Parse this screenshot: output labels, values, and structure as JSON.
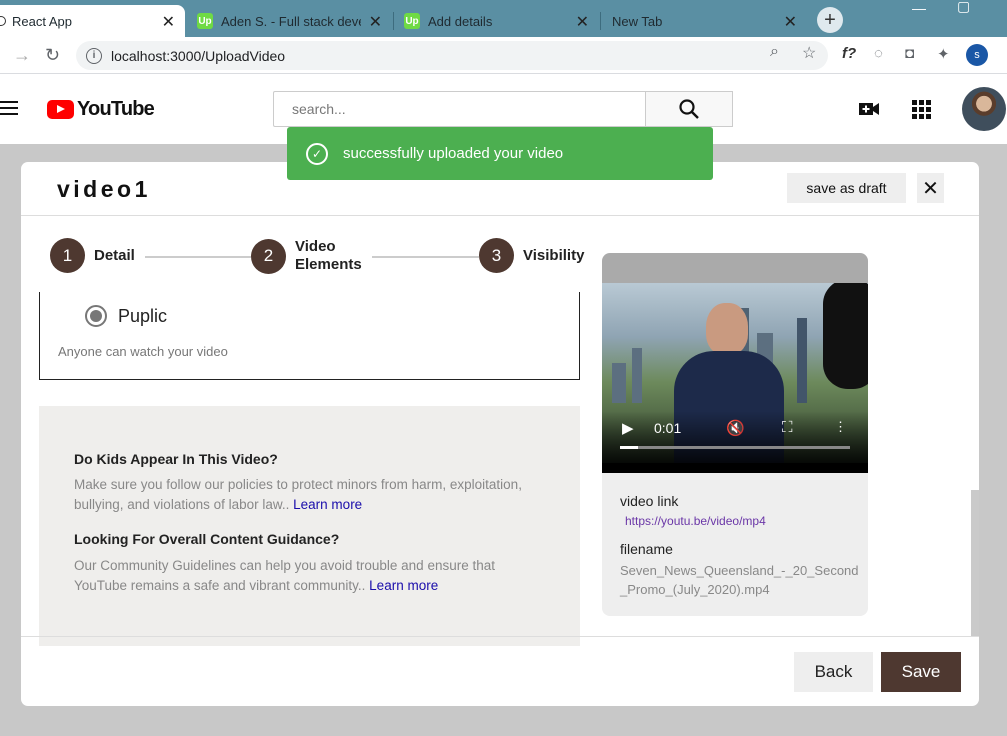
{
  "browser": {
    "tabs": [
      {
        "title": "React App",
        "icon": "react-icon"
      },
      {
        "title": "Aden S. - Full stack develop",
        "icon": "upwork-icon"
      },
      {
        "title": "Add details",
        "icon": "upwork-icon"
      },
      {
        "title": "New Tab",
        "icon": ""
      }
    ],
    "url": "localhost:3000/UploadVideo",
    "profile_initial": "s"
  },
  "youtube": {
    "logo_text": "YouTube",
    "search_placeholder": "search..."
  },
  "toast": {
    "message": "successfully uploaded your video",
    "color": "#4caf50"
  },
  "modal": {
    "title": "video1",
    "save_draft_label": "save as draft",
    "steps": [
      {
        "number": "1",
        "label": "Detail"
      },
      {
        "number": "2",
        "label_line1": "Video",
        "label_line2": "Elements"
      },
      {
        "number": "3",
        "label": "Visibility"
      }
    ],
    "visibility": {
      "option_label": "Puplic",
      "description": "Anyone can watch your video"
    },
    "kids": {
      "heading": "Do Kids Appear In This Video?",
      "text": "Make sure you follow our policies to protect minors from harm, exploitation, bullying, and violations of labor law..",
      "link": "Learn more"
    },
    "guidance": {
      "heading": "Looking For Overall Content Guidance?",
      "text": "Our Community Guidelines can help you avoid trouble and ensure that YouTube remains a safe and vibrant community..",
      "link": "Learn more"
    },
    "video": {
      "time": "0:01",
      "progress": 0.08,
      "link_label": "video link",
      "link": "https://youtu.be/video/mp4",
      "filename_label": "filename",
      "filename": "Seven_News_Queensland_-_20_Second_Promo_(July_2020).mp4"
    },
    "back_label": "Back",
    "save_label": "Save",
    "accent_color": "#4e3830"
  }
}
